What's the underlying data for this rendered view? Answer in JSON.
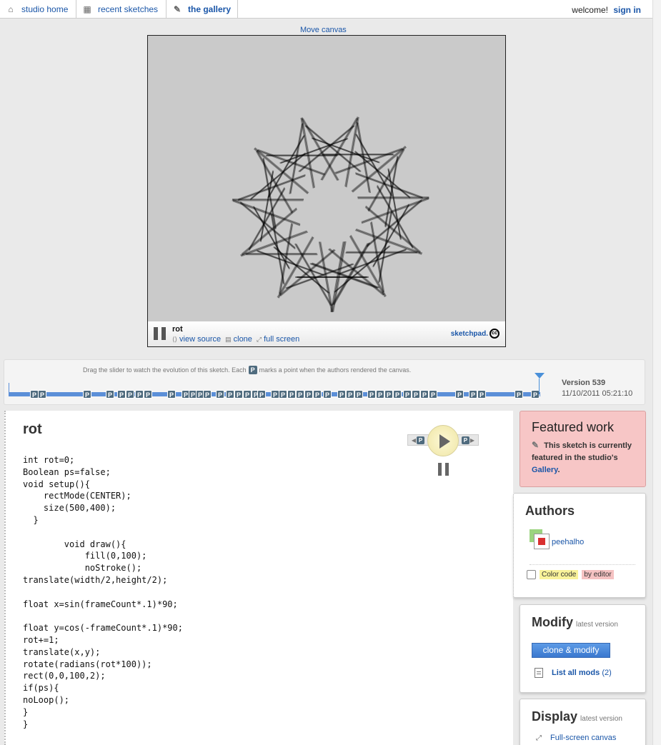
{
  "nav": {
    "tabs": [
      {
        "label": "studio home",
        "icon": "house-icon"
      },
      {
        "label": "recent sketches",
        "icon": "calendar-icon"
      },
      {
        "label": "the gallery",
        "icon": "pushpin-icon"
      }
    ],
    "welcome": "welcome!",
    "sign_in": "sign in"
  },
  "canvas": {
    "move_label": "Move canvas",
    "sketch_name": "rot",
    "view_source": "view source",
    "clone": "clone",
    "full_screen": "full screen",
    "logo": "sketchpad.",
    "cc": "cc",
    "background": "#cacaca"
  },
  "timeline": {
    "hint_before": "Drag the slider to watch the evolution of this sketch. Each",
    "hint_badge": "P",
    "hint_after": "marks a point when the authors rendered the canvas.",
    "badge_label": "P",
    "version": "Version 539",
    "date": "11/10/2011 05:21:10"
  },
  "code": {
    "title": "rot",
    "lines": [
      "int rot=0;",
      "Boolean ps=false;",
      "void setup(){",
      "    rectMode(CENTER);",
      "    size(500,400);",
      "  }",
      "",
      "        void draw(){",
      "            fill(0,100);",
      "            noStroke();",
      "translate(width/2,height/2);",
      "",
      "float x=sin(frameCount*.1)*90;",
      "",
      "float y=cos(-frameCount*.1)*90;",
      "rot+=1;",
      "translate(x,y);",
      "rotate(radians(rot*100));",
      "rect(0,0,100,2);",
      "if(ps){",
      "noLoop();",
      "}",
      "}"
    ]
  },
  "featured": {
    "title": "Featured work",
    "text": "This sketch is currently featured in the studio's",
    "link": "Gallery",
    "tail": "."
  },
  "authors": {
    "title": "Authors",
    "name": "peehalho",
    "color_code": "Color code",
    "by_editor": "by editor"
  },
  "modify": {
    "title": "Modify",
    "subtitle": "latest version",
    "button": "clone & modify",
    "list_mods": "List all mods",
    "mods_count": "(2)"
  },
  "display": {
    "title": "Display",
    "subtitle": "latest version",
    "fullscreen": "Full-screen canvas"
  },
  "colors": {
    "link": "#1a56a8",
    "featured_bg": "#f7c6c6",
    "timeline_track": "#5b8fd8",
    "button": "#3a78cf"
  }
}
